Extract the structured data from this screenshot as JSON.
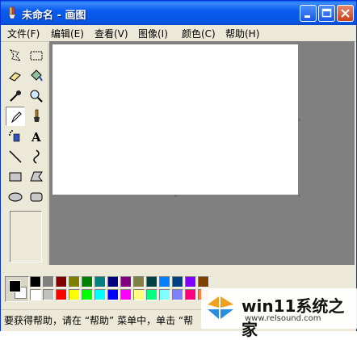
{
  "window": {
    "title": "未命名 - 画图"
  },
  "menu": [
    {
      "label": "文件(F)"
    },
    {
      "label": "编辑(E)"
    },
    {
      "label": "查看(V)"
    },
    {
      "label": "图像(I)"
    },
    {
      "label": "颜色(C)"
    },
    {
      "label": "帮助(H)"
    }
  ],
  "tools": [
    {
      "icon": "free-select-icon"
    },
    {
      "icon": "rect-select-icon"
    },
    {
      "icon": "eraser-icon"
    },
    {
      "icon": "fill-icon"
    },
    {
      "icon": "color-picker-icon"
    },
    {
      "icon": "magnifier-icon"
    },
    {
      "icon": "pencil-icon",
      "active": true
    },
    {
      "icon": "brush-icon"
    },
    {
      "icon": "airbrush-icon"
    },
    {
      "icon": "text-icon",
      "glyph": "A"
    },
    {
      "icon": "line-icon"
    },
    {
      "icon": "curve-icon"
    },
    {
      "icon": "rectangle-icon"
    },
    {
      "icon": "polygon-icon"
    },
    {
      "icon": "ellipse-icon"
    },
    {
      "icon": "rounded-rect-icon"
    }
  ],
  "colors": {
    "foreground": "#000000",
    "background": "#ffffff",
    "palette_row1": [
      "#000000",
      "#808080",
      "#800000",
      "#808000",
      "#008000",
      "#008080",
      "#000080",
      "#800080",
      "#808040",
      "#004040",
      "#0080ff",
      "#004080",
      "#8000ff",
      "#804000"
    ],
    "palette_row2": [
      "#ffffff",
      "#c0c0c0",
      "#ff0000",
      "#ffff00",
      "#00ff00",
      "#00ffff",
      "#0000ff",
      "#ff00ff",
      "#ffff80",
      "#00ff80",
      "#80ffff",
      "#8080ff",
      "#ff0080",
      "#ff8040"
    ]
  },
  "status": {
    "text": "要获得帮助，请在 “帮助” 菜单中，单击 “帮"
  },
  "watermark": {
    "title": "win11系统之家",
    "url": "www.relsound.com"
  }
}
